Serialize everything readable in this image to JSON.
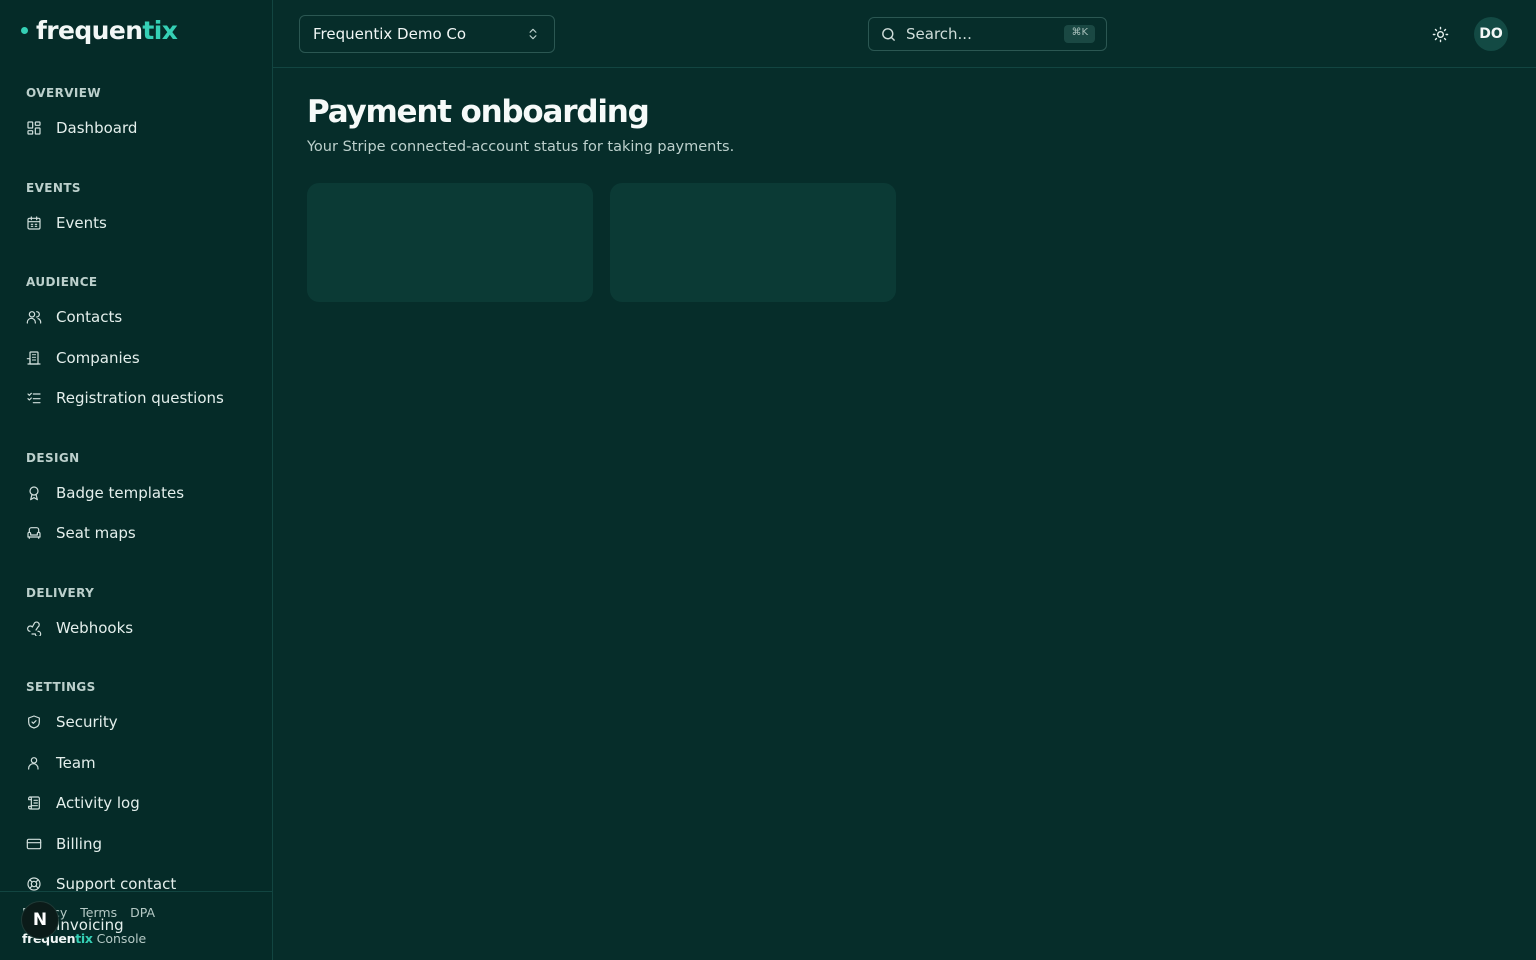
{
  "brand": {
    "name_main": "frequen",
    "name_accent": "tix"
  },
  "sidebar": {
    "groups": [
      {
        "heading": "OVERVIEW",
        "items": [
          {
            "label": "Dashboard",
            "icon": "dashboard-icon"
          }
        ]
      },
      {
        "heading": "EVENTS",
        "items": [
          {
            "label": "Events",
            "icon": "calendar-icon"
          }
        ]
      },
      {
        "heading": "AUDIENCE",
        "items": [
          {
            "label": "Contacts",
            "icon": "users-icon"
          },
          {
            "label": "Companies",
            "icon": "building-icon"
          },
          {
            "label": "Registration questions",
            "icon": "checklist-icon"
          }
        ]
      },
      {
        "heading": "DESIGN",
        "items": [
          {
            "label": "Badge templates",
            "icon": "badge-icon"
          },
          {
            "label": "Seat maps",
            "icon": "armchair-icon"
          }
        ]
      },
      {
        "heading": "DELIVERY",
        "items": [
          {
            "label": "Webhooks",
            "icon": "webhook-icon"
          }
        ]
      },
      {
        "heading": "SETTINGS",
        "items": [
          {
            "label": "Security",
            "icon": "shield-icon"
          },
          {
            "label": "Team",
            "icon": "user-icon"
          },
          {
            "label": "Activity log",
            "icon": "scroll-icon"
          },
          {
            "label": "Billing",
            "icon": "credit-card-icon"
          },
          {
            "label": "Support contact",
            "icon": "lifebuoy-icon"
          },
          {
            "label": "Invoicing",
            "icon": "receipt-icon"
          }
        ]
      }
    ],
    "footer": {
      "links": [
        "Privacy",
        "Terms",
        "DPA"
      ],
      "console_brand_main": "frequen",
      "console_brand_accent": "tix",
      "console_suffix": " Console",
      "next_badge": "N"
    }
  },
  "topbar": {
    "org_name": "Frequentix Demo Co",
    "search_placeholder": "Search...",
    "search_shortcut": "⌘K",
    "avatar_initials": "DO"
  },
  "main": {
    "title": "Payment onboarding",
    "subtitle": "Your Stripe connected-account status for taking payments."
  },
  "colors": {
    "accent": "#35d0b5",
    "background": "#062d2a",
    "card": "#0b3a35"
  }
}
